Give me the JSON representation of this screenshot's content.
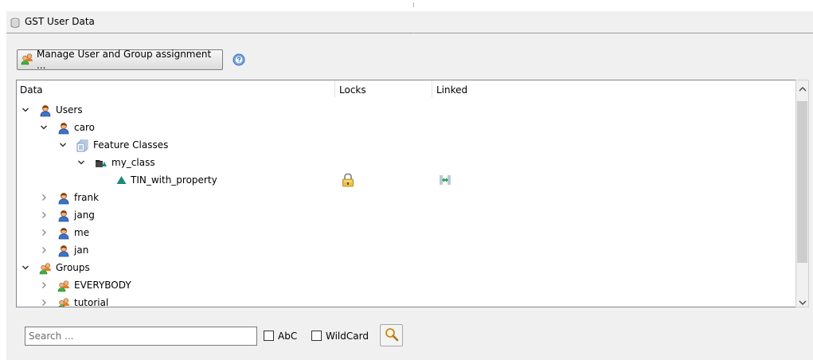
{
  "window": {
    "title": "GST User Data"
  },
  "toolbar": {
    "manage_button_label": "Manage User and Group assignment ..."
  },
  "tree": {
    "columns": [
      "Data",
      "Locks",
      "Linked"
    ],
    "rows": [
      {
        "label": "Users",
        "expanded": true,
        "icon": "user-icon"
      },
      {
        "label": "caro",
        "expanded": true,
        "icon": "user-icon"
      },
      {
        "label": "Feature Classes",
        "expanded": true,
        "icon": "feature-classes-icon"
      },
      {
        "label": "my_class",
        "expanded": true,
        "icon": "class-folder-icon"
      },
      {
        "label": "TIN_with_property",
        "icon": "tin-triangle-icon",
        "locked": true,
        "linked": true
      },
      {
        "label": "frank",
        "expanded": false,
        "icon": "user-icon"
      },
      {
        "label": "jang",
        "expanded": false,
        "icon": "user-icon"
      },
      {
        "label": "me",
        "expanded": false,
        "icon": "user-icon"
      },
      {
        "label": "jan",
        "expanded": false,
        "icon": "user-icon"
      },
      {
        "label": "Groups",
        "expanded": true,
        "icon": "group-icon"
      },
      {
        "label": "EVERYBODY",
        "expanded": false,
        "icon": "group-icon"
      },
      {
        "label": "tutorial",
        "expanded": false,
        "icon": "group-icon"
      }
    ]
  },
  "search": {
    "placeholder": "Search ...",
    "value": "",
    "abc_label": "AbC",
    "abc_checked": false,
    "wildcard_label": "WildCard",
    "wildcard_checked": false
  },
  "colors": {
    "tree_border": "#828790",
    "panel_background": "#f0f0f0",
    "tin_color": "#1a8a7a"
  }
}
